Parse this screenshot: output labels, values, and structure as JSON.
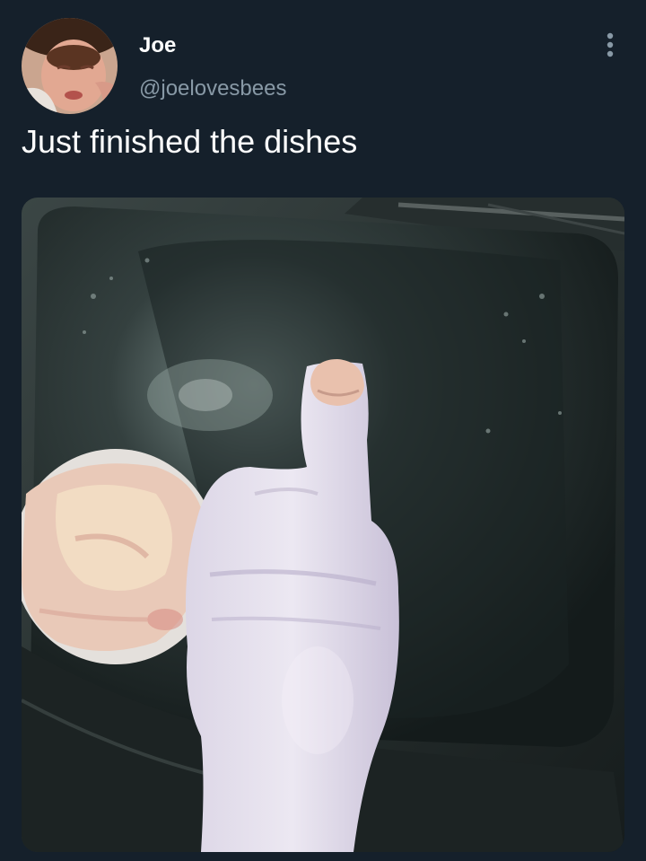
{
  "tweet": {
    "author_name": "Joe",
    "author_handle": "@joelovesbees",
    "text": "Just finished the dishes"
  },
  "icons": {
    "more": "more-vertical-icon",
    "avatar": "profile-photo",
    "media": "photo-raw-chicken-thumbs-up-in-sink"
  },
  "colors": {
    "background": "#15202b",
    "handle": "#8899a6",
    "text": "#ffffff"
  }
}
